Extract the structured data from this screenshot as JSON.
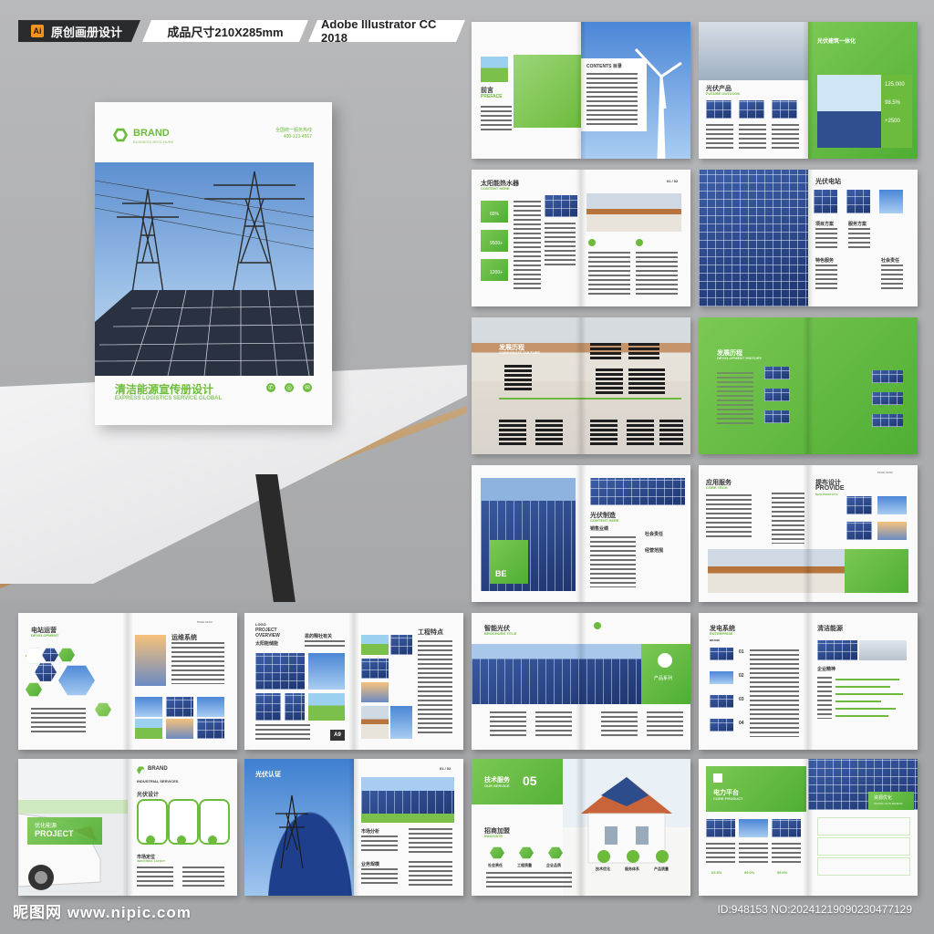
{
  "header": {
    "tag_left": "原创画册设计",
    "tag_left_icon": "Ai",
    "tag_middle": "成品尺寸210X285mm",
    "tag_right": "Adobe Illustrator CC 2018"
  },
  "cover": {
    "brand": "BRAND",
    "brand_sub": "BUSINESS BROCHURE",
    "hotline_label": "全国统一服务热线",
    "hotline": "400-123-4567",
    "title_cn": "清洁能源宣传册设计",
    "title_en": "EXPRESS LOGISTICS SERVICE GLOBAL",
    "accent": "#6dbb3c"
  },
  "spreads": {
    "s1": {
      "title_cn": "前言",
      "title_en": "PREFACE",
      "contents_title": "CONTENTS 目录"
    },
    "s2": {
      "title_cn": "光伏产品",
      "title_en": "FUTURE OUTLOOK",
      "title2": "光伏建筑一体化",
      "stat1": "125.000",
      "stat2": "98.5%",
      "stat3": "+2500"
    },
    "s3": {
      "title_cn": "太阳能热水器",
      "title_en": "CONTENT HERE",
      "stat1": "65%",
      "stat2": "9500+",
      "stat3": "1200+",
      "page": "01 / 02"
    },
    "s4": {
      "title_cn": "光伏电站",
      "col1": "项目方案",
      "col2": "服务方案",
      "col3": "特色服务",
      "col4": "社会责任"
    },
    "s5": {
      "title_cn": "发展历程",
      "title_en": "CORPORATE CULTURE"
    },
    "s6": {
      "title_cn": "发展历程",
      "title_en": "DEVELOPMENT HISTORY"
    },
    "s7": {
      "title_cn": "光伏制造",
      "title_en": "CONTENT HERE",
      "badge": "BE",
      "item1": "销售业绩",
      "item2": "社会责任",
      "item3": "经营范围"
    },
    "s8": {
      "title_cn": "应用服务",
      "title_en": "CORE TECH",
      "title2_cn": "提布设计",
      "title2_en": "PROVIDE",
      "sub2": "NEW PRODUCTS",
      "page": "PAGE 01/02"
    },
    "s9": {
      "title_cn": "电站运营",
      "title_en": "DEVELOPMENT",
      "title2": "运维系统",
      "page": "PAGE 01/02"
    },
    "s10": {
      "logo": "LOGO",
      "title_en": "PROJECT OVERVIEW",
      "title_cn": "太阳能储能",
      "sub": "思的释社有关",
      "badge": "A9",
      "title2": "工程特点"
    },
    "s11": {
      "title_cn": "智能光伏",
      "title_en": "BROCHURE TITLE",
      "label": "产品系列"
    },
    "s12": {
      "title_cn": "发电系统",
      "title_en": "ENTERPRISE",
      "sub": "BRAND",
      "title2": "清洁能源",
      "n1": "01",
      "n2": "02",
      "n3": "03",
      "n4": "04",
      "title3": "企业精神"
    },
    "s13": {
      "brand": "BRAND",
      "title_en": "INDUSTRIAL SERVICES",
      "title_cn": "光伏设计",
      "overlay_cn": "优化能源",
      "overlay_en": "PROJECT",
      "label1": "市场定位",
      "label2": "INDUSTRIAL LAYOUT"
    },
    "s14": {
      "title_cn": "光伏认证",
      "page": "01 / 02",
      "item1": "市场分析",
      "item2": "业务规模"
    },
    "s15": {
      "title_cn": "技术服务",
      "title_en": "OUR SERVICE",
      "num": "05",
      "title2": "招商加盟",
      "sub2": "INNOVATE",
      "i1": "社会责任",
      "i2": "工程质量",
      "i3": "企业品质",
      "i4": "技术优化",
      "i5": "服务体系",
      "i6": "产品质量"
    },
    "s16": {
      "title_cn": "电力平台",
      "title_en": "CORE PRODUCT",
      "title2": "资源优化",
      "sub2": "SCOPE OF BUSINESS",
      "pct1": "65.5%",
      "pct2": "99.0%",
      "pct3": "59.0%"
    }
  },
  "footer": {
    "watermark": "昵图网 www.nipic.com",
    "id_text": "ID:948153 NO:20241219090230477129"
  }
}
